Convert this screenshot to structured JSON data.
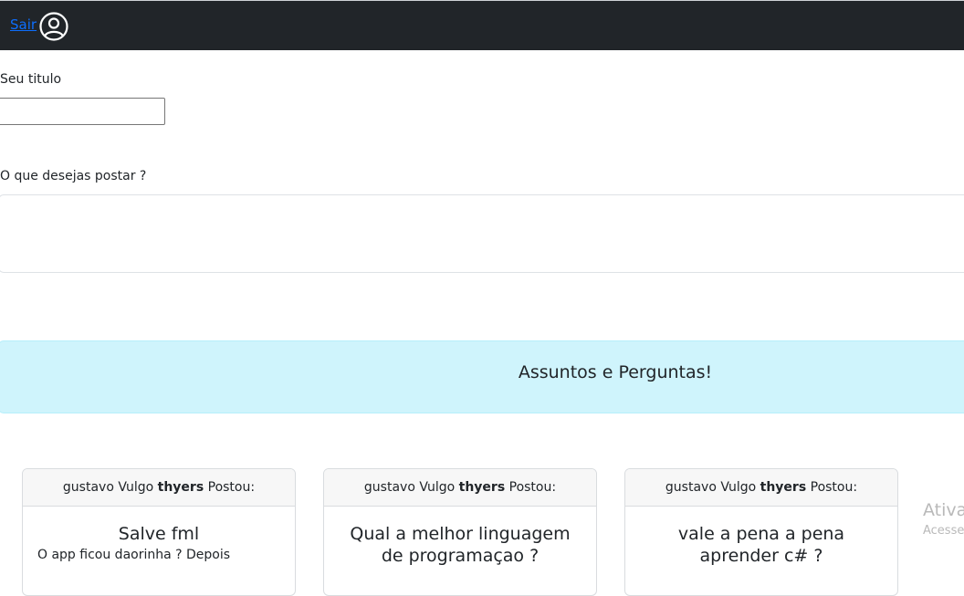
{
  "navbar": {
    "logout_label": "Sair",
    "user_icon": "user-circle-icon"
  },
  "form": {
    "title_label": "Seu titulo",
    "title_value": "",
    "post_label": "O que desejas postar ?",
    "post_value": ""
  },
  "banner": {
    "text": "Assuntos e Perguntas!",
    "color": "#cff4fc"
  },
  "cards": [
    {
      "author": "gustavo",
      "vulgo_word": "Vulgo",
      "nickname": "thyers",
      "posted_word": "Postou:",
      "title": "Salve fml",
      "body": "O app ficou daorinha ? Depois"
    },
    {
      "author": "gustavo",
      "vulgo_word": "Vulgo",
      "nickname": "thyers",
      "posted_word": "Postou:",
      "title": "Qual a melhor linguagem de programaçao ?",
      "body": ""
    },
    {
      "author": "gustavo",
      "vulgo_word": "Vulgo",
      "nickname": "thyers",
      "posted_word": "Postou:",
      "title": "vale a pena a pena aprender c# ?",
      "body": ""
    }
  ],
  "watermark": {
    "line1": "Ativa",
    "line2": "Acesse"
  },
  "colors": {
    "navbar_bg": "#212529",
    "link": "#0d6efd"
  }
}
